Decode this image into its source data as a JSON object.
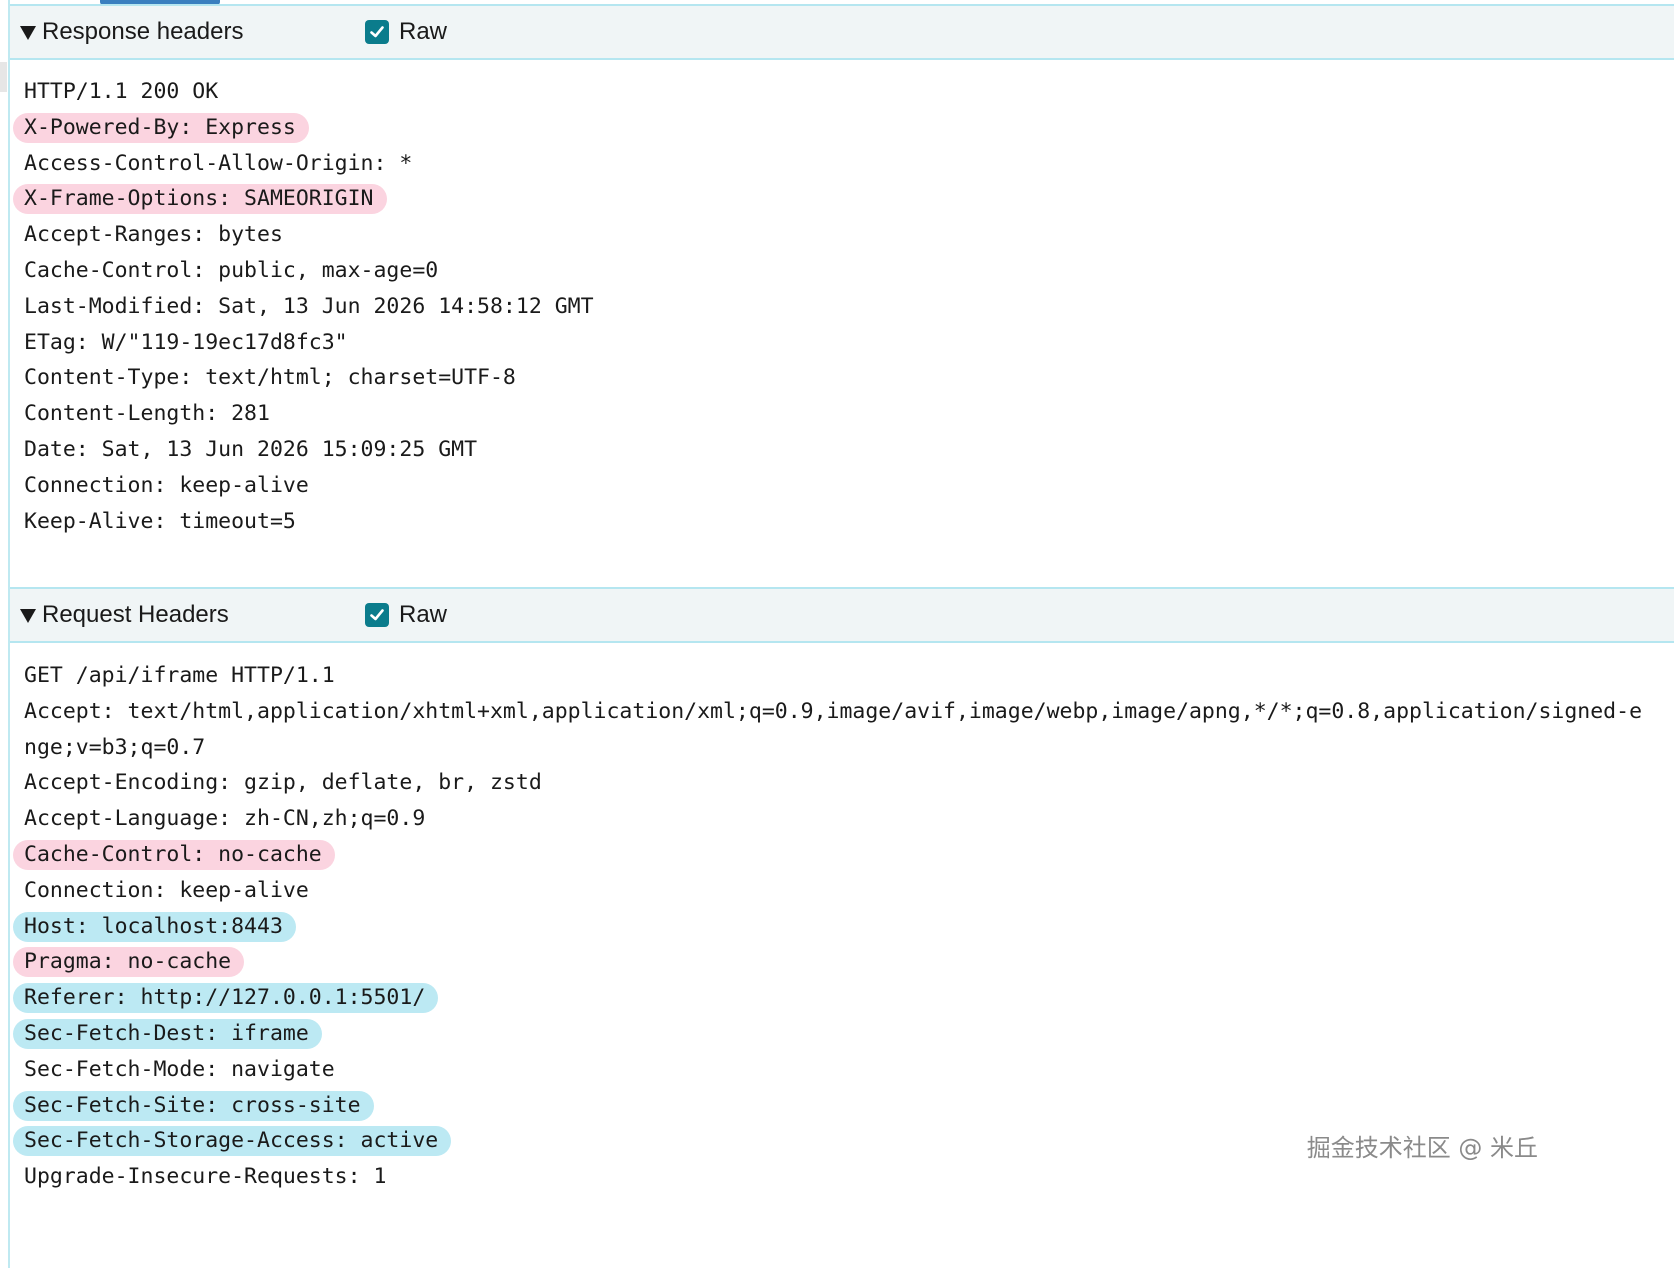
{
  "response": {
    "title": "Response headers",
    "raw_label": "Raw",
    "raw_checked": true,
    "lines": [
      {
        "text": "HTTP/1.1 200 OK",
        "highlight": ""
      },
      {
        "text": "X-Powered-By: Express",
        "highlight": "pink"
      },
      {
        "text": "Access-Control-Allow-Origin: *",
        "highlight": ""
      },
      {
        "text": "X-Frame-Options: SAMEORIGIN",
        "highlight": "pink"
      },
      {
        "text": "Accept-Ranges: bytes",
        "highlight": ""
      },
      {
        "text": "Cache-Control: public, max-age=0",
        "highlight": ""
      },
      {
        "text": "Last-Modified: Sat, 13 Jun 2026 14:58:12 GMT",
        "highlight": ""
      },
      {
        "text": "ETag: W/\"119-19ec17d8fc3\"",
        "highlight": ""
      },
      {
        "text": "Content-Type: text/html; charset=UTF-8",
        "highlight": ""
      },
      {
        "text": "Content-Length: 281",
        "highlight": ""
      },
      {
        "text": "Date: Sat, 13 Jun 2026 15:09:25 GMT",
        "highlight": ""
      },
      {
        "text": "Connection: keep-alive",
        "highlight": ""
      },
      {
        "text": "Keep-Alive: timeout=5",
        "highlight": ""
      }
    ]
  },
  "request": {
    "title": "Request Headers",
    "raw_label": "Raw",
    "raw_checked": true,
    "lines": [
      {
        "text": "GET /api/iframe HTTP/1.1",
        "highlight": ""
      },
      {
        "text": "Accept: text/html,application/xhtml+xml,application/xml;q=0.9,image/avif,image/webp,image/apng,*/*;q=0.8,application/signed-e",
        "highlight": ""
      },
      {
        "text": "nge;v=b3;q=0.7",
        "highlight": ""
      },
      {
        "text": "Accept-Encoding: gzip, deflate, br, zstd",
        "highlight": ""
      },
      {
        "text": "Accept-Language: zh-CN,zh;q=0.9",
        "highlight": ""
      },
      {
        "text": "Cache-Control: no-cache",
        "highlight": "pink"
      },
      {
        "text": "Connection: keep-alive",
        "highlight": ""
      },
      {
        "text": "Host: localhost:8443",
        "highlight": "blue"
      },
      {
        "text": "Pragma: no-cache",
        "highlight": "pink"
      },
      {
        "text": "Referer: http://127.0.0.1:5501/",
        "highlight": "blue"
      },
      {
        "text": "Sec-Fetch-Dest: iframe",
        "highlight": "blue"
      },
      {
        "text": "Sec-Fetch-Mode: navigate",
        "highlight": ""
      },
      {
        "text": "Sec-Fetch-Site: cross-site",
        "highlight": "blue"
      },
      {
        "text": "Sec-Fetch-Storage-Access: active",
        "highlight": "blue"
      },
      {
        "text": "Upgrade-Insecure-Requests: 1",
        "highlight": ""
      }
    ]
  },
  "watermark": "掘金技术社区 @ 米丘",
  "colors": {
    "accent": "#0b7c8c",
    "highlight_pink": "#fbd4e0",
    "highlight_blue": "#bce9f3",
    "border": "#b5e6f0",
    "header_bg": "#f0f5f6"
  }
}
